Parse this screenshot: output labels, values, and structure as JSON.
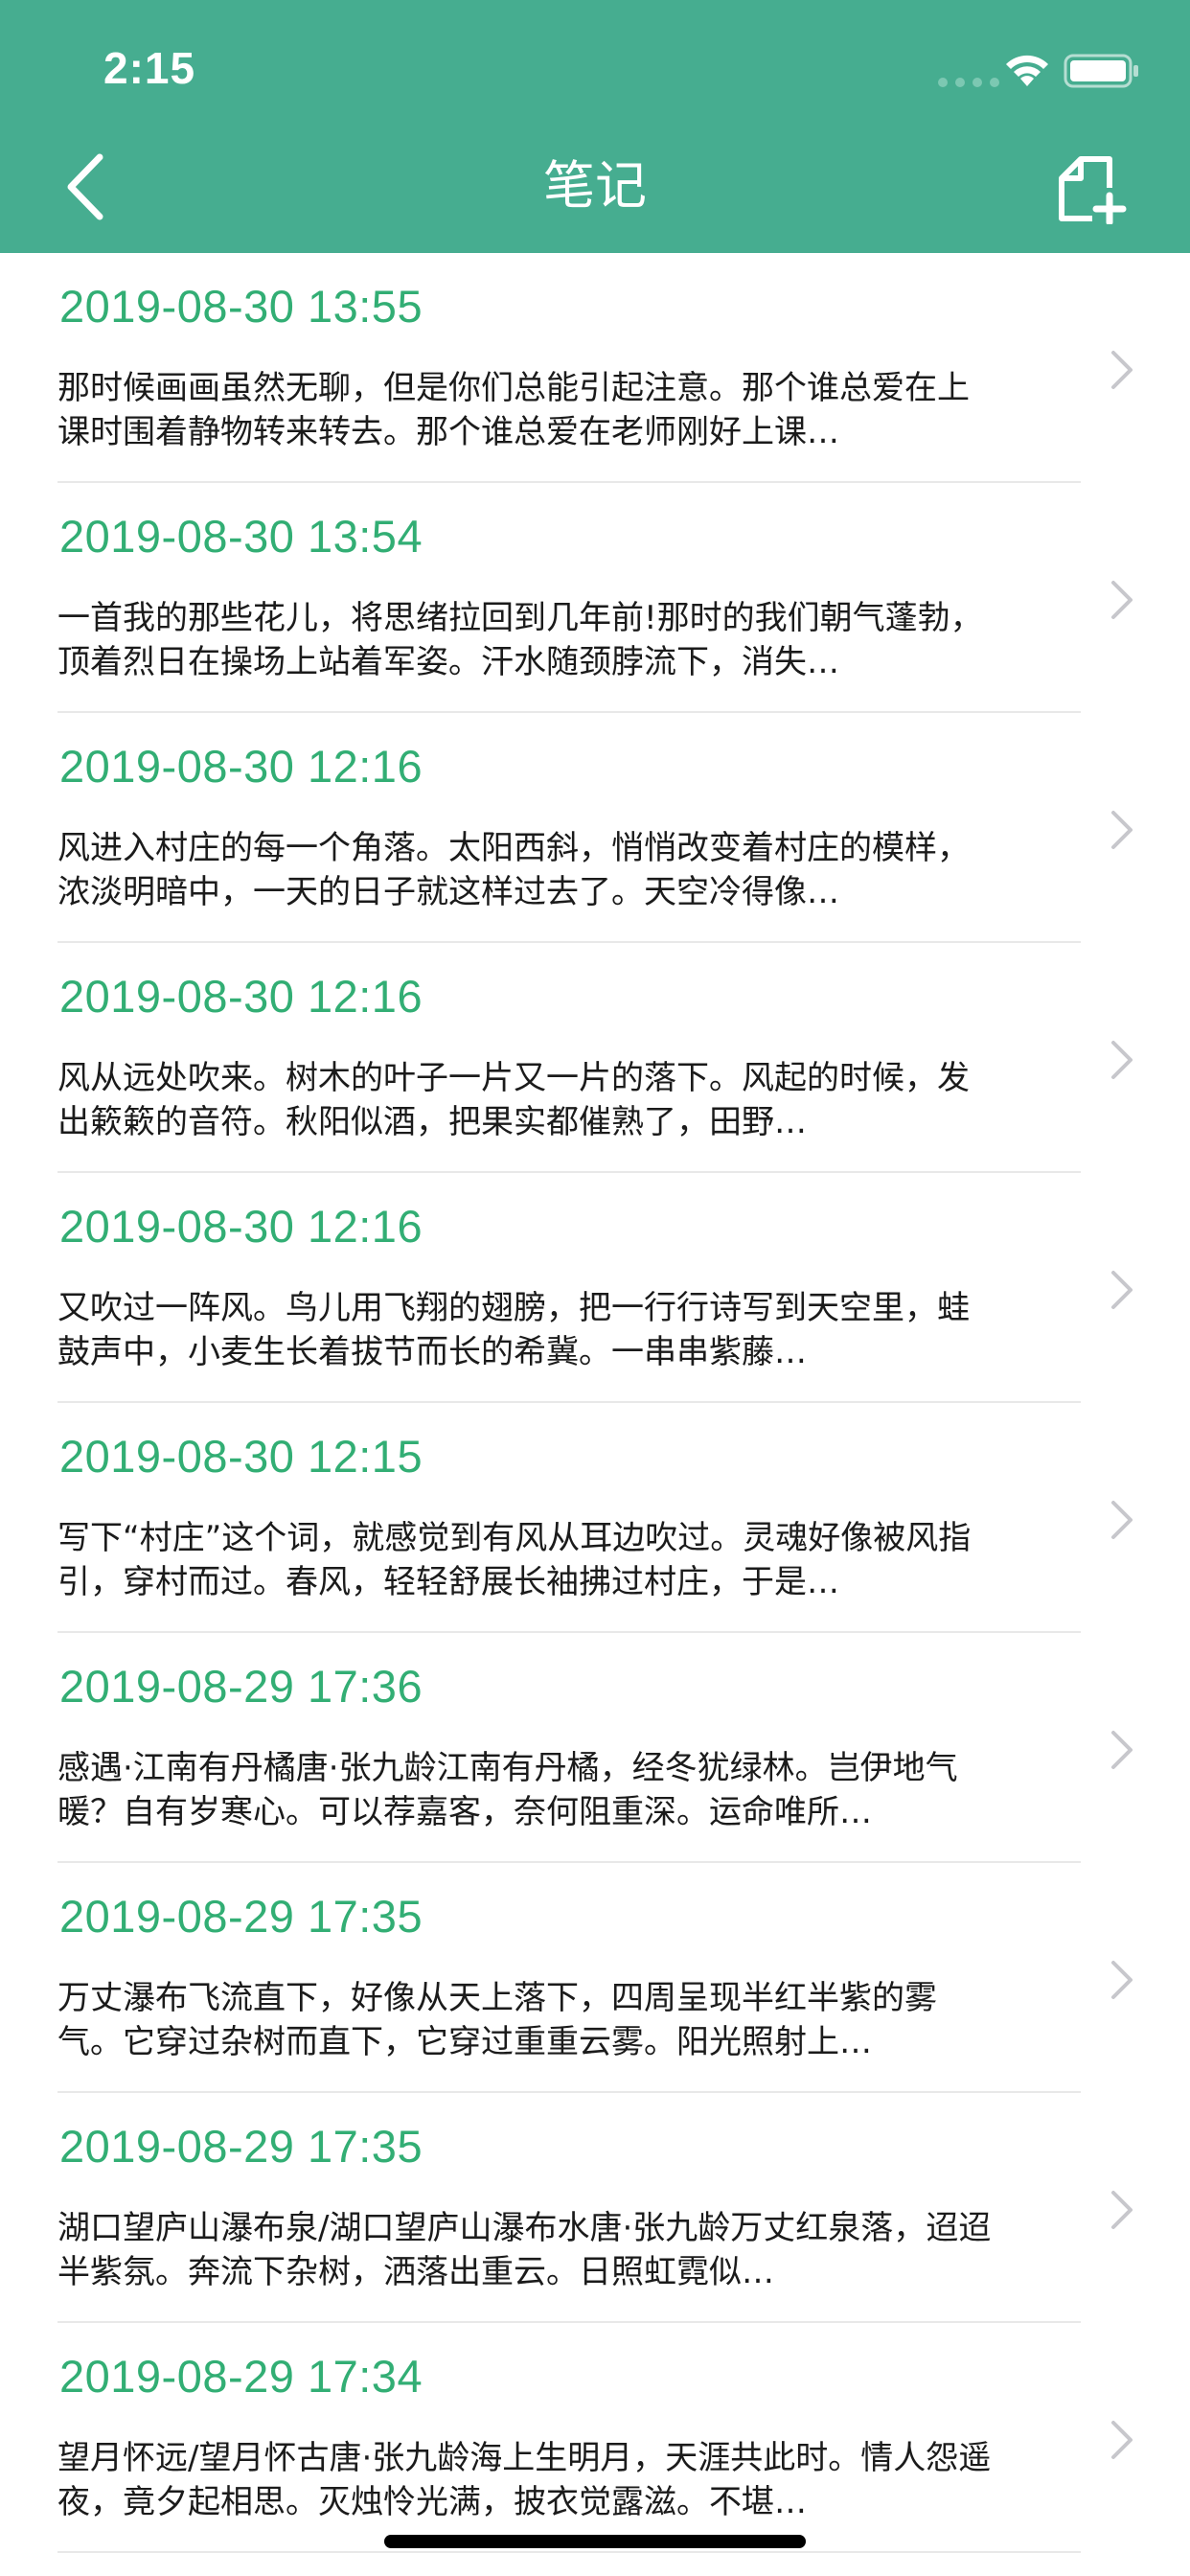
{
  "status_bar": {
    "time": "2:15",
    "icons": [
      "signal-icon",
      "wifi-icon",
      "battery-icon"
    ]
  },
  "nav": {
    "title": "笔记",
    "back_icon": "chevron-left-icon",
    "new_note_icon": "new-note-icon"
  },
  "colors": {
    "header_bg": "#46ad90",
    "date_text": "#32ae74",
    "body_text": "#1b1b1b",
    "chevron": "#c7c7cc",
    "divider": "#e8e8e8"
  },
  "notes": [
    {
      "date": "2019-08-30 13:55",
      "preview": "那时候画画虽然无聊，但是你们总能引起注意。那个谁总爱在上课时围着静物转来转去。那个谁总爱在老师刚好上课…"
    },
    {
      "date": "2019-08-30 13:54",
      "preview": "一首我的那些花儿，将思绪拉回到几年前!那时的我们朝气蓬勃，顶着烈日在操场上站着军姿。汗水随颈脖流下，消失…"
    },
    {
      "date": "2019-08-30 12:16",
      "preview": "风进入村庄的每一个角落。太阳西斜，悄悄改变着村庄的模样，浓淡明暗中，一天的日子就这样过去了。天空冷得像…"
    },
    {
      "date": "2019-08-30 12:16",
      "preview": "风从远处吹来。树木的叶子一片又一片的落下。风起的时候，发出簌簌的音符。秋阳似酒，把果实都催熟了，田野…"
    },
    {
      "date": "2019-08-30 12:16",
      "preview": "又吹过一阵风。鸟儿用飞翔的翅膀，把一行行诗写到天空里，蛙鼓声中，小麦生长着拔节而长的希冀。一串串紫藤…"
    },
    {
      "date": "2019-08-30 12:15",
      "preview": "写下“村庄”这个词，就感觉到有风从耳边吹过。灵魂好像被风指引，穿村而过。春风，轻轻舒展长袖拂过村庄，于是…"
    },
    {
      "date": "2019-08-29 17:36",
      "preview": "感遇·江南有丹橘唐·张九龄江南有丹橘，经冬犹绿林。岂伊地气暖？自有岁寒心。可以荐嘉客，奈何阻重深。运命唯所…"
    },
    {
      "date": "2019-08-29 17:35",
      "preview": "万丈瀑布飞流直下，好像从天上落下，四周呈现半红半紫的雾气。它穿过杂树而直下，它穿过重重云雾。阳光照射上…"
    },
    {
      "date": "2019-08-29 17:35",
      "preview": "湖口望庐山瀑布泉/湖口望庐山瀑布水唐·张九龄万丈红泉落，迢迢半紫氛。奔流下杂树，洒落出重云。日照虹霓似…"
    },
    {
      "date": "2019-08-29 17:34",
      "preview": "望月怀远/望月怀古唐·张九龄海上生明月，天涯共此时。情人怨遥夜，竟夕起相思。灭烛怜光满，披衣觉露滋。不堪…"
    }
  ]
}
